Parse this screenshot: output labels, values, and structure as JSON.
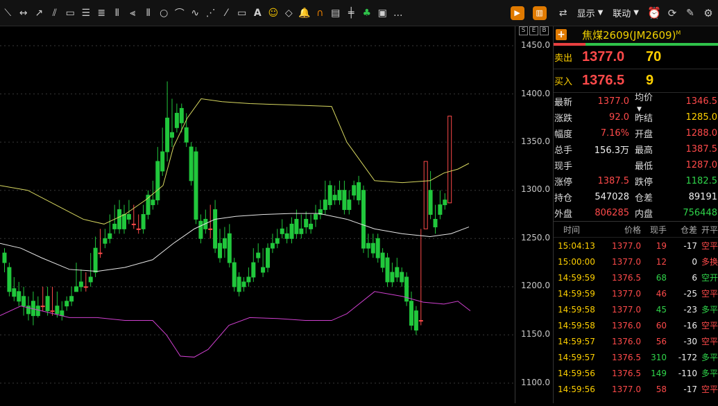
{
  "toolbar": {
    "tools": [
      "line-segment-icon",
      "ray-icon",
      "arrow-icon",
      "parallel-lines-icon",
      "rectangle-icon",
      "fibonacci-icon",
      "fibonacci-retracement-icon",
      "gann-icon",
      "speed-lines-icon",
      "cycle-lines-icon",
      "circle-icon",
      "arc-icon",
      "wave-icon",
      "fan-icon",
      "pencil-icon",
      "ruler-icon",
      "text-icon",
      "emoji-icon",
      "eraser-icon",
      "alarm-bell-icon",
      "magnet-icon",
      "note-icon",
      "crosshair-icon",
      "clover-icon",
      "picture-icon",
      "more-icon"
    ],
    "text_label": "A",
    "more_label": "...",
    "display_label": "显示",
    "link_label": "联动"
  },
  "axis": {
    "labels": [
      "1450.0",
      "1400.0",
      "1350.0",
      "1300.0",
      "1250.0",
      "1200.0",
      "1150.0",
      "1100.0"
    ]
  },
  "side_buttons": [
    "S",
    "E",
    "B"
  ],
  "panel": {
    "plus_label": "+",
    "title": "焦煤2609(JM2609)",
    "title_sup": "M",
    "sell": {
      "label": "卖出",
      "price": "1377.0",
      "vol": "70"
    },
    "buy": {
      "label": "买入",
      "price": "1376.5",
      "vol": "9"
    },
    "stats": [
      {
        "k1": "最新",
        "v1": "1377.0",
        "c1": "red",
        "k2": "均价",
        "v2": "1346.5",
        "c2": "red"
      },
      {
        "k1": "涨跌",
        "v1": "92.0",
        "c1": "red",
        "k2": "昨结",
        "v2": "1285.0",
        "c2": "yellow"
      },
      {
        "k1": "幅度",
        "v1": "7.16%",
        "c1": "red",
        "k2": "开盘",
        "v2": "1288.0",
        "c2": "red"
      },
      {
        "k1": "总手",
        "v1": "156.3万",
        "c1": "white",
        "k2": "最高",
        "v2": "1387.5",
        "c2": "red"
      },
      {
        "k1": "现手",
        "v1": "",
        "c1": "white",
        "k2": "最低",
        "v2": "1287.0",
        "c2": "red"
      },
      {
        "k1": "涨停",
        "v1": "1387.5",
        "c1": "red",
        "k2": "跌停",
        "v2": "1182.5",
        "c2": "green"
      },
      {
        "k1": "持仓",
        "v1": "547028",
        "c1": "white",
        "k2": "仓差",
        "v2": "89191",
        "c2": "white"
      },
      {
        "k1": "外盘",
        "v1": "806285",
        "c1": "red",
        "k2": "内盘",
        "v2": "756448",
        "c2": "green"
      }
    ],
    "tick_header": [
      "时间",
      "价格",
      "现手",
      "仓差",
      "开平"
    ],
    "ticks": [
      {
        "time": "15:04:13",
        "price": "1377.0",
        "vol": "19",
        "vc": "red",
        "oi": "-17",
        "type": "空平",
        "tc": "red"
      },
      {
        "time": "15:00:00",
        "price": "1377.0",
        "vol": "12",
        "vc": "red",
        "oi": "0",
        "type": "多换",
        "tc": "red"
      },
      {
        "time": "14:59:59",
        "price": "1376.5",
        "vol": "68",
        "vc": "green",
        "oi": "6",
        "type": "空开",
        "tc": "green"
      },
      {
        "time": "14:59:59",
        "price": "1377.0",
        "vol": "46",
        "vc": "red",
        "oi": "-25",
        "type": "空平",
        "tc": "red"
      },
      {
        "time": "14:59:58",
        "price": "1377.0",
        "vol": "45",
        "vc": "green",
        "oi": "-23",
        "type": "多平",
        "tc": "green"
      },
      {
        "time": "14:59:58",
        "price": "1376.0",
        "vol": "60",
        "vc": "red",
        "oi": "-16",
        "type": "空平",
        "tc": "red"
      },
      {
        "time": "14:59:57",
        "price": "1376.0",
        "vol": "56",
        "vc": "red",
        "oi": "-30",
        "type": "空平",
        "tc": "red"
      },
      {
        "time": "14:59:57",
        "price": "1376.5",
        "vol": "310",
        "vc": "green",
        "oi": "-172",
        "type": "多平",
        "tc": "green"
      },
      {
        "time": "14:59:56",
        "price": "1376.5",
        "vol": "149",
        "vc": "green",
        "oi": "-110",
        "type": "多平",
        "tc": "green"
      },
      {
        "time": "14:59:56",
        "price": "1377.0",
        "vol": "58",
        "vc": "red",
        "oi": "-17",
        "type": "空平",
        "tc": "red"
      }
    ]
  },
  "colors": {
    "up": "#ff4a4a",
    "down": "#21c73c",
    "upper_band": "#d8d860",
    "mid_band": "#e8e8e8",
    "lower_band": "#d040d0",
    "price_label": "#c8c8c8"
  }
}
